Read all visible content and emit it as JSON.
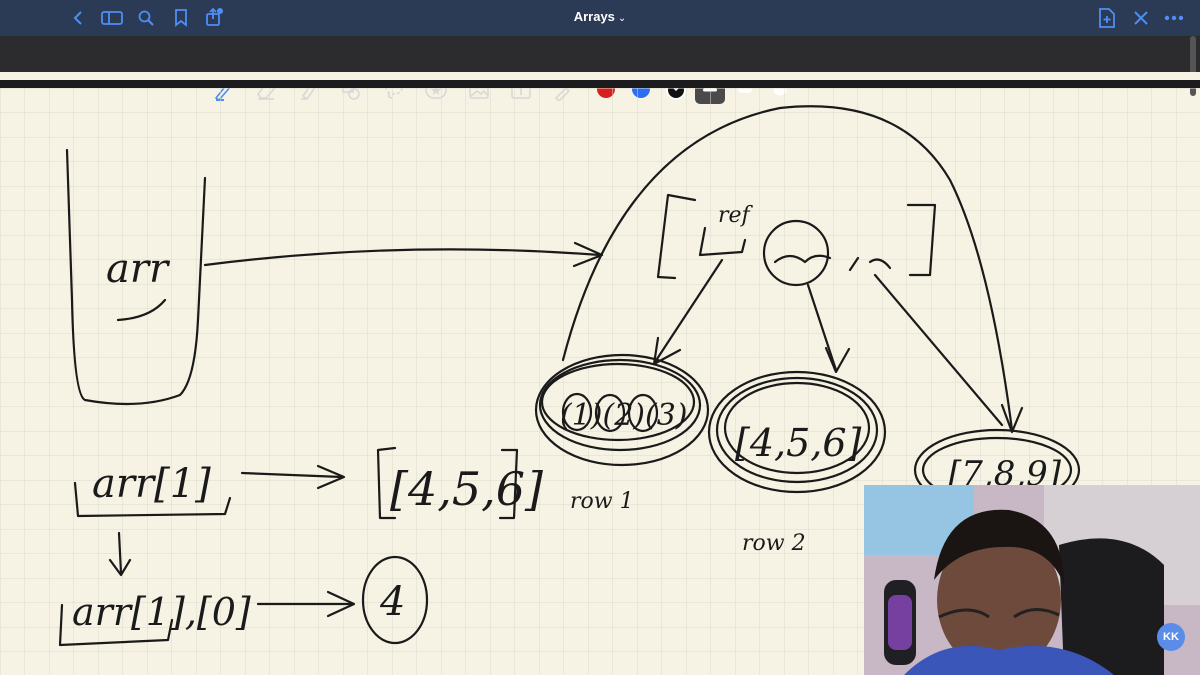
{
  "window": {
    "title": "Arrays"
  },
  "top_left_icons": [
    "back-icon",
    "sidebar-icon",
    "search-icon",
    "bookmark-icon",
    "share-icon"
  ],
  "top_right_icons": [
    "new-page-icon",
    "close-icon",
    "more-icon"
  ],
  "toolbar": {
    "tools": [
      "pen-icon",
      "eraser-icon",
      "highlighter-icon",
      "shapes-icon",
      "lasso-icon",
      "sticker-icon",
      "image-icon",
      "text-icon",
      "laser-icon"
    ],
    "colors": [
      "#d92020",
      "#2c6df2",
      "#111111"
    ],
    "selected_color": "#111111"
  },
  "notes": {
    "box_label": "arr",
    "expr1": "arr[1]",
    "result1": "[4,5,6]",
    "expr2": "arr[1],[0]",
    "result2": "4",
    "row1_label": "row 1",
    "row2_label": "row 2",
    "ref_label": "ref",
    "row1_values": "(1)(2)(3)",
    "row2_values": "[4,5,6]",
    "row3_values": "[7,8,9]"
  },
  "webcam": {
    "badge": "KK"
  }
}
